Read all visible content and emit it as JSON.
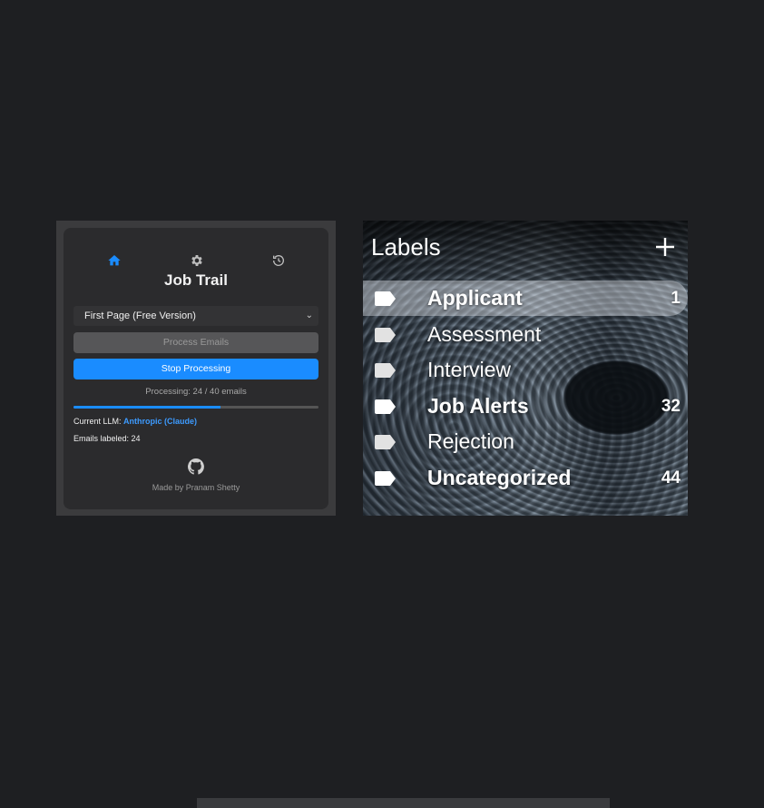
{
  "popup": {
    "nav": {
      "home_icon": "home-icon",
      "settings_icon": "gear-icon",
      "history_icon": "history-icon",
      "active": "home",
      "accent_color": "#1a8cff"
    },
    "title": "Job Trail",
    "select": {
      "value": "First Page (Free Version)"
    },
    "process_button": "Process Emails",
    "stop_button": "Stop Processing",
    "status": "Processing: 24 / 40 emails",
    "progress": {
      "current": 24,
      "total": 40
    },
    "llm_label": "Current LLM:",
    "llm_value": "Anthropic (Claude)",
    "emails_labeled": "Emails labeled: 24",
    "github_icon": "github-icon",
    "credit": "Made by Pranam Shetty"
  },
  "labels": {
    "header": "Labels",
    "add_icon": "plus-icon",
    "items": [
      {
        "name": "Applicant",
        "count": "1",
        "selected": true,
        "bold": true
      },
      {
        "name": "Assessment",
        "count": "",
        "selected": false,
        "bold": false
      },
      {
        "name": "Interview",
        "count": "",
        "selected": false,
        "bold": false
      },
      {
        "name": "Job Alerts",
        "count": "32",
        "selected": false,
        "bold": true
      },
      {
        "name": "Rejection",
        "count": "",
        "selected": false,
        "bold": false
      },
      {
        "name": "Uncategorized",
        "count": "44",
        "selected": false,
        "bold": true
      }
    ]
  }
}
